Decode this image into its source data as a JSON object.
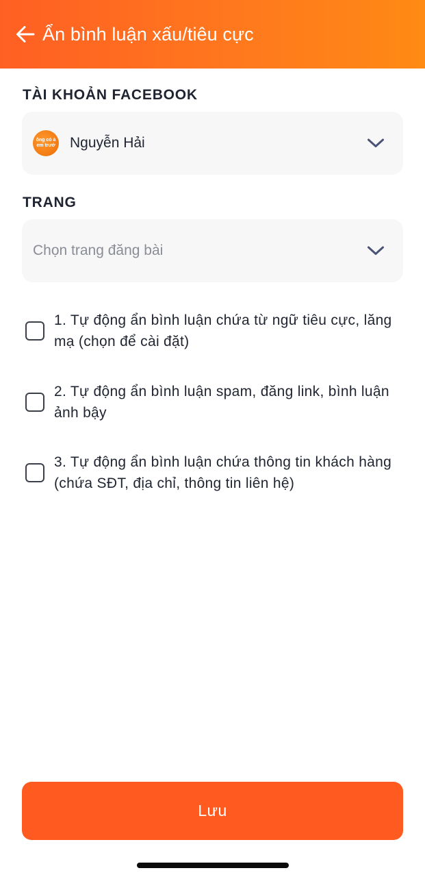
{
  "header": {
    "title": "Ẩn bình luận xấu/tiêu cực",
    "back_icon": "arrow-left-icon",
    "gradient_start": "#ff5f23",
    "gradient_end": "#ff8a14"
  },
  "account": {
    "label": "TÀI KHOẢN FACEBOOK",
    "selected_name": "Nguyễn Hải",
    "avatar_text_line1": "ông có ả",
    "avatar_text_line2": "em trướ"
  },
  "page_select": {
    "label": "TRANG",
    "placeholder": "Chọn trang đăng bài"
  },
  "options": [
    {
      "text": "1. Tự động ẩn bình luận chứa từ ngữ tiêu cực, lăng mạ (chọn để cài đặt)",
      "checked": false
    },
    {
      "text": "2. Tự động ẩn bình luận spam, đăng link, bình luận ảnh bậy",
      "checked": false
    },
    {
      "text": "3. Tự động ẩn bình luận chứa thông tin khách hàng (chứa SĐT, địa chỉ, thông tin liên hệ)",
      "checked": false
    }
  ],
  "save_button": {
    "label": "Lưu",
    "color": "#ff5a1f"
  },
  "icons": {
    "chevron": "chevron-down-icon",
    "checkbox": "checkbox-icon"
  }
}
